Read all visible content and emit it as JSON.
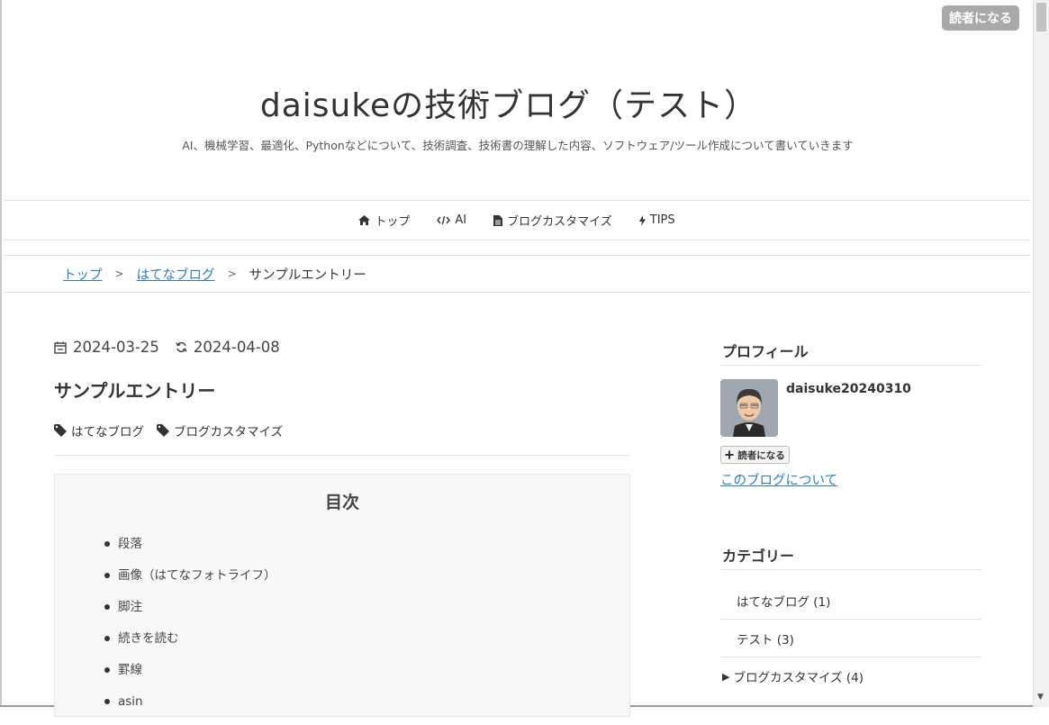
{
  "header": {
    "reader_button": "読者になる",
    "title": "daisukeの技術ブログ（テスト）",
    "description": "AI、機械学習、最適化、Pythonなどについて、技術調査、技術書の理解した内容、ソフトウェア/ツール作成について書いていきます"
  },
  "nav": {
    "items": [
      {
        "label": "トップ",
        "icon": "home-icon"
      },
      {
        "label": "AI",
        "icon": "code-icon"
      },
      {
        "label": "ブログカスタマイズ",
        "icon": "file-icon"
      },
      {
        "label": "TIPS",
        "icon": "bolt-icon"
      }
    ]
  },
  "breadcrumb": {
    "items": [
      "トップ",
      "はてなブログ",
      "サンプルエントリー"
    ],
    "separator": ">"
  },
  "entry": {
    "date_created": "2024-03-25",
    "date_updated": "2024-04-08",
    "title": "サンプルエントリー",
    "tags": [
      "はてなブログ",
      "ブログカスタマイズ"
    ]
  },
  "toc": {
    "title": "目次",
    "items": [
      "段落",
      "画像（はてなフォトライフ）",
      "脚注",
      "続きを読む",
      "罫線",
      "asin"
    ]
  },
  "sidebar": {
    "profile": {
      "heading": "プロフィール",
      "name": "daisuke20240310",
      "reader_button": "読者になる",
      "about_link": "このブログについて"
    },
    "categories": {
      "heading": "カテゴリー",
      "items": [
        "はてなブログ (1)",
        "テスト (3)",
        "ブログカスタマイズ (4)"
      ]
    }
  },
  "colors": {
    "link": "#2f7cc2",
    "reader_button_bg": "#a9a9a9",
    "text": "#333333"
  }
}
